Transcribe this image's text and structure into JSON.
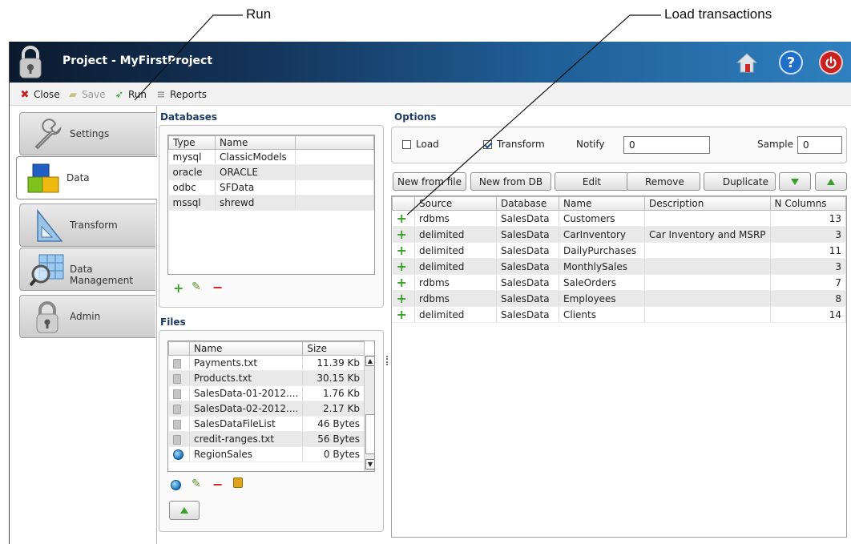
{
  "callouts": {
    "run": "Run",
    "load_transactions": "Load transactions"
  },
  "window": {
    "title": "Project - MyFirstProject"
  },
  "toolbar": {
    "close": "Close",
    "save": "Save",
    "run": "Run",
    "reports": "Reports"
  },
  "nav": {
    "items": [
      {
        "label": "Settings"
      },
      {
        "label": "Data",
        "active": true
      },
      {
        "label": "Transform"
      },
      {
        "label": "Data Management"
      },
      {
        "label": "Admin"
      }
    ]
  },
  "databases": {
    "title": "Databases",
    "columns": [
      "Type",
      "Name"
    ],
    "rows": [
      [
        "mysql",
        "ClassicModels"
      ],
      [
        "oracle",
        "ORACLE"
      ],
      [
        "odbc",
        "SFData"
      ],
      [
        "mssql",
        "shrewd"
      ]
    ]
  },
  "files": {
    "title": "Files",
    "columns": [
      "Name",
      "Size"
    ],
    "rows": [
      [
        "Payments.txt",
        "11.39 Kb"
      ],
      [
        "Products.txt",
        "30.15 Kb"
      ],
      [
        "SalesData-01-2012....",
        "1.76 Kb"
      ],
      [
        "SalesData-02-2012....",
        "2.17 Kb"
      ],
      [
        "SalesDataFileList",
        "46 Bytes"
      ],
      [
        "credit-ranges.txt",
        "56 Bytes"
      ],
      [
        "RegionSales",
        "0 Bytes"
      ]
    ]
  },
  "options": {
    "title": "Options",
    "load_label": "Load",
    "transform_label": "Transform",
    "notify_label": "Notify",
    "notify_value": "0",
    "sample_label": "Sample",
    "sample_value": "0"
  },
  "buttons": {
    "new_from_file": "New from file",
    "new_from_db": "New from DB",
    "edit": "Edit",
    "remove": "Remove",
    "duplicate": "Duplicate"
  },
  "sources": {
    "columns": [
      "Source",
      "Database",
      "Name",
      "Description",
      "N Columns"
    ],
    "rows": [
      [
        "rdbms",
        "SalesData",
        "Customers",
        "",
        "13"
      ],
      [
        "delimited",
        "SalesData",
        "CarInventory",
        "Car Inventory and MSRP",
        "3"
      ],
      [
        "delimited",
        "SalesData",
        "DailyPurchases",
        "",
        "11"
      ],
      [
        "delimited",
        "SalesData",
        "MonthlySales",
        "",
        "3"
      ],
      [
        "rdbms",
        "SalesData",
        "SaleOrders",
        "",
        "7"
      ],
      [
        "rdbms",
        "SalesData",
        "Employees",
        "",
        "8"
      ],
      [
        "delimited",
        "SalesData",
        "Clients",
        "",
        "14"
      ]
    ]
  },
  "colors": {
    "accent": "#1e3d66",
    "plus": "#3aa02a",
    "minus": "#d11b1b"
  }
}
